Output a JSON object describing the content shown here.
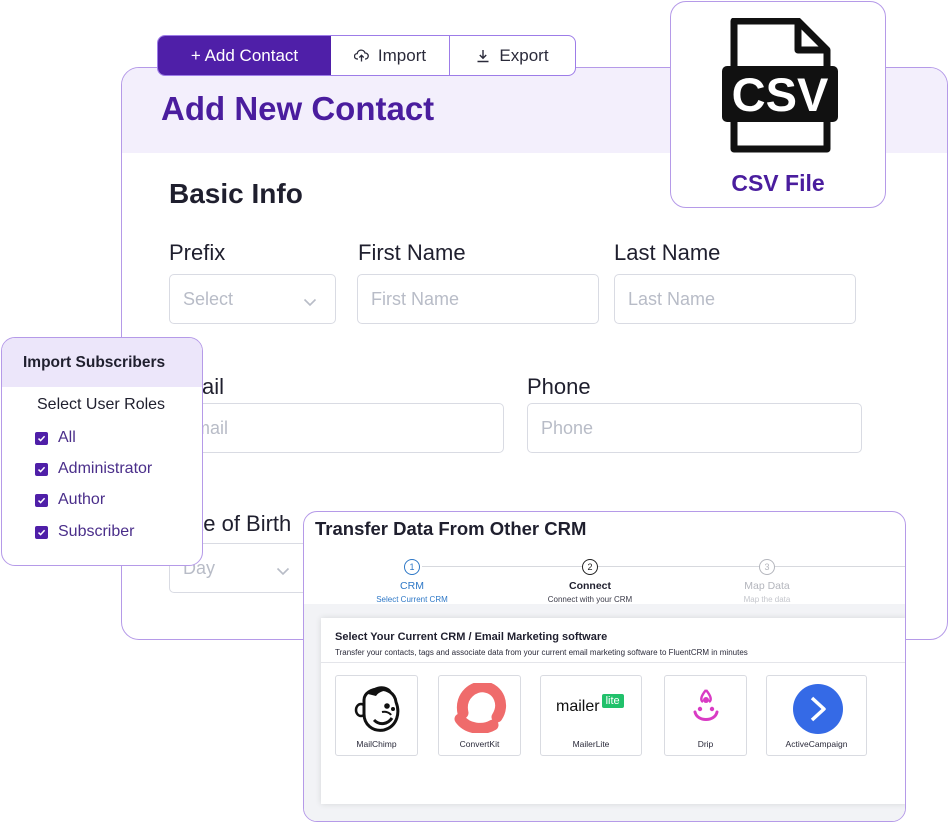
{
  "toolbar": {
    "add_contact": "+ Add Contact",
    "import": "Import",
    "export": "Export"
  },
  "form": {
    "title": "Add New Contact",
    "section": "Basic Info",
    "prefix_label": "Prefix",
    "prefix_placeholder": "Select",
    "first_name_label": "First Name",
    "first_name_placeholder": "First Name",
    "last_name_label": "Last Name",
    "last_name_placeholder": "Last Name",
    "email_label": "Email",
    "email_placeholder": "Email",
    "phone_label": "Phone",
    "phone_placeholder": "Phone",
    "dob_label": "Date of Birth",
    "dob_placeholder": "Day"
  },
  "csv": {
    "icon_text": "CSV",
    "label": "CSV File"
  },
  "import_subscribers": {
    "title": "Import Subscribers",
    "subtitle": "Select User Roles",
    "roles": [
      "All",
      "Administrator",
      "Author",
      "Subscriber"
    ]
  },
  "crm": {
    "title": "Transfer Data From Other CRM",
    "steps": [
      {
        "num": "1",
        "name": "CRM",
        "desc": "Select Current CRM"
      },
      {
        "num": "2",
        "name": "Connect",
        "desc": "Connect with your CRM"
      },
      {
        "num": "3",
        "name": "Map Data",
        "desc": "Map the data"
      }
    ],
    "panel_title": "Select Your Current CRM / Email Marketing software",
    "panel_desc": "Transfer your contacts, tags and associate data from your current email marketing software to FluentCRM in minutes",
    "providers": [
      "MailChimp",
      "ConvertKit",
      "MailerLite",
      "Drip",
      "ActiveCampaign"
    ],
    "mailerlite_logo": "mailer",
    "mailerlite_badge": "lite"
  },
  "colors": {
    "accent": "#4f1fa8",
    "title": "#4a1d9e",
    "border": "#b59ae8",
    "header_bg": "#f3effc"
  }
}
